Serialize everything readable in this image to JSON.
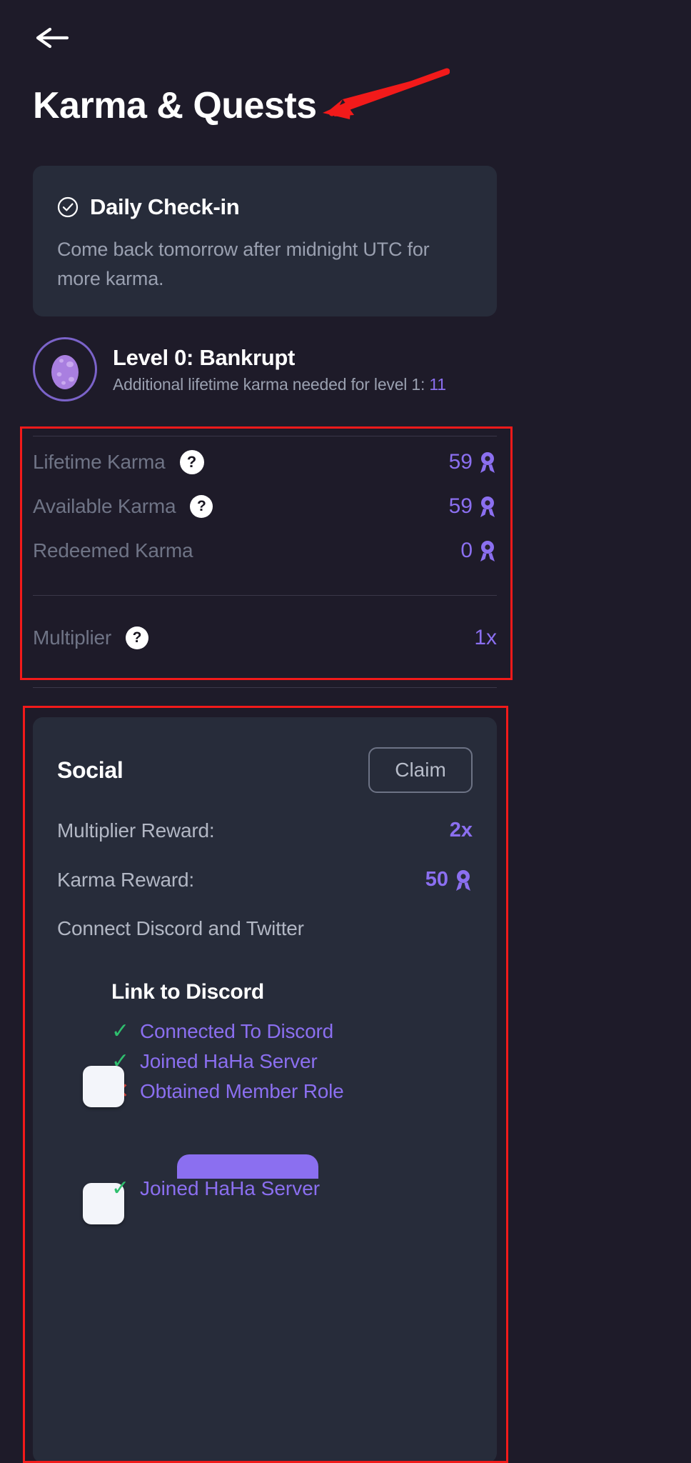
{
  "header": {
    "back_icon": "arrow-left-icon",
    "title": "Karma & Quests"
  },
  "daily_checkin": {
    "icon": "circle-check-icon",
    "title": "Daily Check-in",
    "body": "Come back tomorrow after midnight UTC for more karma."
  },
  "level": {
    "icon": "egg-icon",
    "title": "Level 0: Bankrupt",
    "sub_prefix": "Additional lifetime karma needed for level 1: ",
    "sub_value": "11"
  },
  "stats": {
    "rows": [
      {
        "label": "Lifetime Karma",
        "help": "?",
        "value": "59",
        "icon": "medal-icon"
      },
      {
        "label": "Available Karma",
        "help": "?",
        "value": "59",
        "icon": "medal-icon"
      },
      {
        "label": "Redeemed Karma",
        "help": null,
        "value": "0",
        "icon": "medal-icon"
      }
    ],
    "multiplier": {
      "label": "Multiplier",
      "help": "?",
      "value": "1x"
    }
  },
  "social": {
    "title": "Social",
    "claim_label": "Claim",
    "multiplier_reward_label": "Multiplier Reward:",
    "multiplier_reward_value": "2x",
    "karma_reward_label": "Karma Reward:",
    "karma_reward_value": "50",
    "karma_reward_icon": "medal-icon",
    "description": "Connect Discord and Twitter",
    "tasks": {
      "group_title": "Link to Discord",
      "items": [
        {
          "mark": "✓",
          "status": "ok",
          "label": "Connected To Discord"
        },
        {
          "mark": "✓",
          "status": "ok",
          "label": "Joined HaHa Server"
        },
        {
          "mark": "✕",
          "status": "no",
          "label": "Obtained Member Role"
        }
      ],
      "partial_item": {
        "mark": "✓",
        "status": "ok",
        "label": "Joined HaHa Server"
      }
    }
  },
  "colors": {
    "page_bg": "#1e1b29",
    "card_bg": "#272c3a",
    "accent_purple": "#8b6ff0",
    "success_green": "#2fbf6e",
    "error_red": "#e0453b",
    "annotation_red": "#f21a1a",
    "muted_text": "#9aa0b0"
  }
}
